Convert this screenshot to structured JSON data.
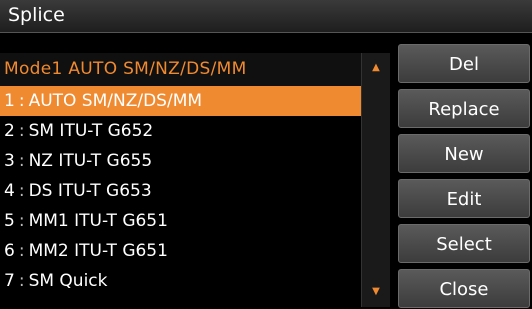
{
  "window": {
    "title": "Splice"
  },
  "header": {
    "mode_text": "Mode1  AUTO  SM/NZ/DS/MM"
  },
  "list": {
    "items": [
      {
        "num": "1",
        "label": "AUTO SM/NZ/DS/MM",
        "selected": true
      },
      {
        "num": "2",
        "label": "SM ITU-T G652"
      },
      {
        "num": "3",
        "label": "NZ ITU-T G655"
      },
      {
        "num": "4",
        "label": "DS ITU-T G653"
      },
      {
        "num": "5",
        "label": "MM1 ITU-T G651"
      },
      {
        "num": "6",
        "label": "MM2 ITU-T G651"
      },
      {
        "num": "7",
        "label": "SM Quick"
      }
    ]
  },
  "scrollbar": {
    "up_icon": "scroll-up-arrow",
    "down_icon": "scroll-down-arrow"
  },
  "buttons": {
    "del": "Del",
    "replace": "Replace",
    "new": "New",
    "edit": "Edit",
    "select": "Select",
    "close": "Close"
  },
  "colors": {
    "accent": "#f08a30",
    "background": "#000000",
    "button": "#4a4a4a"
  }
}
